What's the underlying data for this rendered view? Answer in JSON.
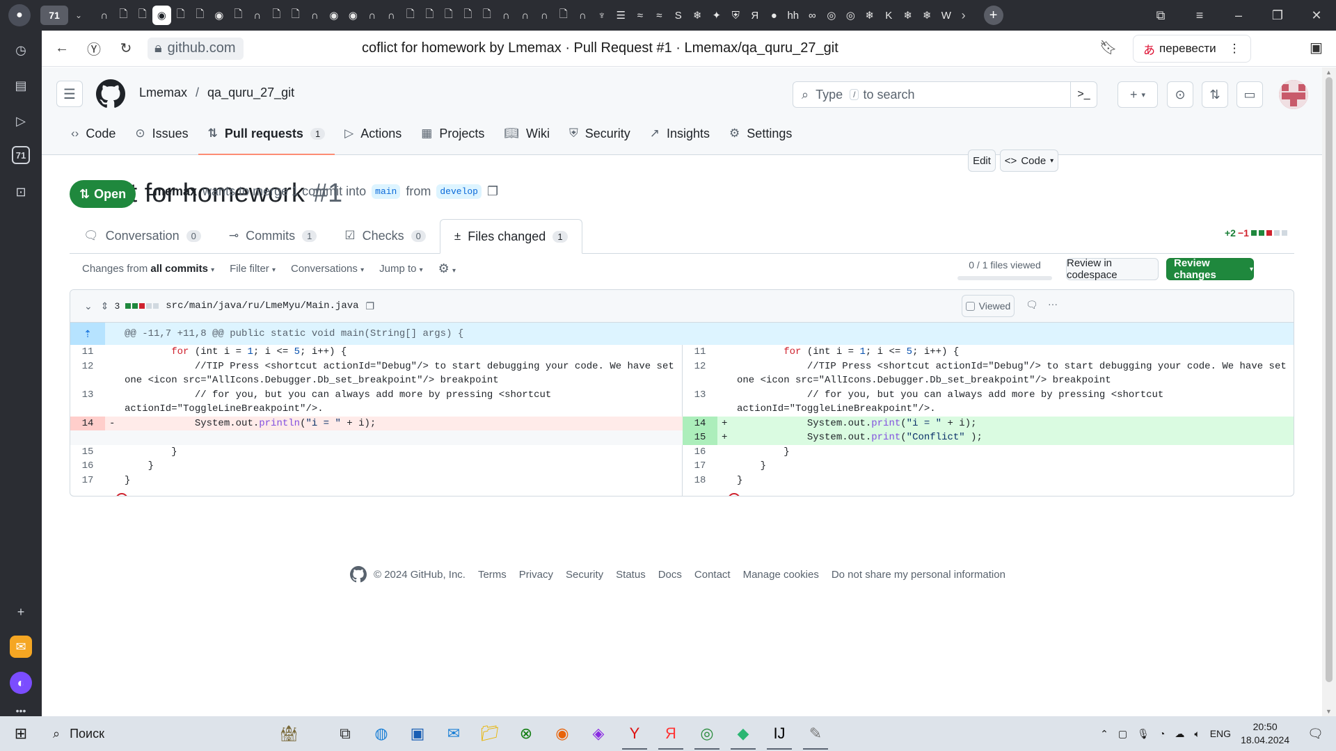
{
  "browser": {
    "tab_count": "71",
    "tab_icons": [
      "n",
      "doc",
      "doc",
      "github",
      "doc",
      "doc",
      "github",
      "doc",
      "n",
      "doc",
      "doc",
      "n",
      "github",
      "github",
      "n",
      "n",
      "doc",
      "doc",
      "doc",
      "doc",
      "doc",
      "n",
      "n",
      "n",
      "doc",
      "n",
      "python",
      "stack",
      "wave",
      "wave",
      "S",
      "snow",
      "star",
      "shield",
      "Я",
      "rec",
      "hh",
      "link",
      "ring",
      "ring",
      "snow",
      "K",
      "snow",
      "snow",
      "W"
    ],
    "active_tab_index": 3,
    "url_domain": "github.com",
    "page_title": "coflict for homework by Lmemax · Pull Request #1 · Lmemax/qa_quru_27_git",
    "translate_label": "перевести"
  },
  "rail": {
    "items": [
      "history-icon",
      "collections-icon",
      "video-icon",
      "tab-count-icon",
      "screenshot-icon"
    ],
    "tab_count": "71"
  },
  "gh": {
    "owner": "Lmemax",
    "repo": "qa_quru_27_git",
    "search_placeholder_pre": "Type",
    "search_key": "/",
    "search_placeholder_post": "to search",
    "nav": [
      {
        "icon": "code-icon",
        "label": "Code"
      },
      {
        "icon": "issue-icon",
        "label": "Issues"
      },
      {
        "icon": "pull-request-icon",
        "label": "Pull requests",
        "count": "1",
        "active": true
      },
      {
        "icon": "play-icon",
        "label": "Actions"
      },
      {
        "icon": "table-icon",
        "label": "Projects"
      },
      {
        "icon": "book-icon",
        "label": "Wiki"
      },
      {
        "icon": "shield-icon",
        "label": "Security"
      },
      {
        "icon": "graph-icon",
        "label": "Insights"
      },
      {
        "icon": "gear-icon",
        "label": "Settings"
      }
    ]
  },
  "pr": {
    "title": "coflict for homework",
    "number": "#1",
    "edit_label": "Edit",
    "code_label": "Code",
    "state": "Open",
    "author": "Lmemax",
    "merge_text": "wants to merge 1 commit into",
    "base_branch": "main",
    "from_text": "from",
    "head_branch": "develop",
    "tabs": [
      {
        "label": "Conversation",
        "count": "0"
      },
      {
        "label": "Commits",
        "count": "1"
      },
      {
        "label": "Checks",
        "count": "0"
      },
      {
        "label": "Files changed",
        "count": "1",
        "active": true
      }
    ],
    "additions": "+2",
    "deletions": "−1"
  },
  "toolbar": {
    "changes_from": "Changes from",
    "all_commits": "all commits",
    "file_filter": "File filter",
    "conversations": "Conversations",
    "jump_to": "Jump to",
    "files_viewed": "0 / 1 files viewed",
    "codespace_label": "Review in codespace",
    "review_label": "Review changes"
  },
  "file": {
    "changes_count": "3",
    "path": "src/main/java/ru/LmeMyu/Main.java",
    "viewed_label": "Viewed",
    "hunk_header": "@@ -11,7 +11,8 @@ public static void main(String[] args) {",
    "left_lines": [
      {
        "n": "11",
        "type": "ctx",
        "code": "        for (int i = 1; i <= 5; i++) {"
      },
      {
        "n": "12",
        "type": "ctx",
        "code": "            //TIP Press <shortcut actionId=\"Debug\"/> to start debugging your code. We have set one <icon src=\"AllIcons.Debugger.Db_set_breakpoint\"/> breakpoint"
      },
      {
        "n": "13",
        "type": "ctx",
        "code": "            // for you, but you can always add more by pressing <shortcut actionId=\"ToggleLineBreakpoint\"/>."
      },
      {
        "n": "14",
        "type": "del",
        "mark": "-",
        "code": "            System.out.println(\"i = \" + i);"
      },
      {
        "n": "",
        "type": "empty",
        "code": ""
      },
      {
        "n": "15",
        "type": "ctx",
        "code": "        }"
      },
      {
        "n": "16",
        "type": "ctx",
        "code": "    }"
      },
      {
        "n": "17",
        "type": "ctx",
        "code": "}"
      }
    ],
    "right_lines": [
      {
        "n": "11",
        "type": "ctx",
        "code": "        for (int i = 1; i <= 5; i++) {"
      },
      {
        "n": "12",
        "type": "ctx",
        "code": "            //TIP Press <shortcut actionId=\"Debug\"/> to start debugging your code. We have set one <icon src=\"AllIcons.Debugger.Db_set_breakpoint\"/> breakpoint"
      },
      {
        "n": "13",
        "type": "ctx",
        "code": "            // for you, but you can always add more by pressing <shortcut actionId=\"ToggleLineBreakpoint\"/>."
      },
      {
        "n": "14",
        "type": "add",
        "mark": "+",
        "code": "            System.out.print(\"i = \" + i);"
      },
      {
        "n": "15",
        "type": "add",
        "mark": "+",
        "code": "            System.out.print(\"Conflict\" );"
      },
      {
        "n": "16",
        "type": "ctx",
        "code": "        }"
      },
      {
        "n": "17",
        "type": "ctx",
        "code": "    }"
      },
      {
        "n": "18",
        "type": "ctx",
        "code": "}"
      }
    ]
  },
  "footer": {
    "copyright": "© 2024 GitHub, Inc.",
    "links": [
      "Terms",
      "Privacy",
      "Security",
      "Status",
      "Docs",
      "Contact",
      "Manage cookies",
      "Do not share my personal information"
    ]
  },
  "taskbar": {
    "search_label": "Поиск",
    "apps": [
      "village-icon",
      "task-view-icon",
      "edge-icon",
      "store-icon",
      "mail-icon",
      "explorer-icon",
      "xbox-icon",
      "firefox-icon",
      "photo-icon",
      "yandex-y-icon",
      "yandex-ya-icon",
      "chrome-icon",
      "gitkraken-icon",
      "intellij-icon",
      "paint-icon"
    ],
    "language": "ENG",
    "time": "20:50",
    "date": "18.04.2024"
  },
  "colors": {
    "accent_green": "#1f883d",
    "link_blue": "#0969da",
    "del_bg": "#ffebe9",
    "add_bg": "#dafbe1",
    "underline": "#fd8c73"
  }
}
